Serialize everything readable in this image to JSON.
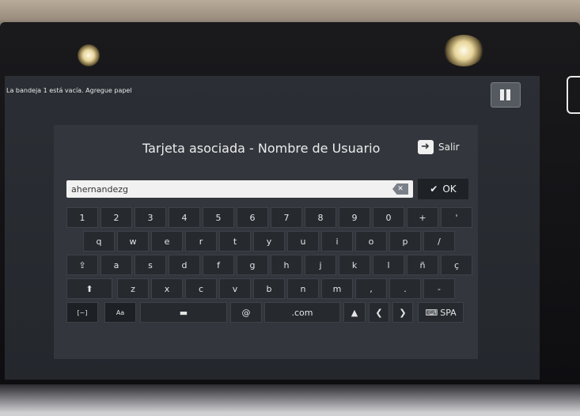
{
  "status": {
    "message": "La bandeja 1 está vacía. Agregue papel"
  },
  "header": {
    "title": "Tarjeta asociada - Nombre de Usuario",
    "exit_label": "Salir"
  },
  "input": {
    "value": "ahernandezg"
  },
  "ok": {
    "label": "OK"
  },
  "keyboard": {
    "row1": [
      "1",
      "2",
      "3",
      "4",
      "5",
      "6",
      "7",
      "8",
      "9",
      "0",
      "+",
      "'"
    ],
    "row2": [
      "q",
      "w",
      "e",
      "r",
      "t",
      "y",
      "u",
      "i",
      "o",
      "p",
      "/"
    ],
    "row3": [
      "a",
      "s",
      "d",
      "f",
      "g",
      "h",
      "j",
      "k",
      "l",
      "ñ",
      "ç"
    ],
    "row4": [
      "z",
      "x",
      "c",
      "v",
      "b",
      "n",
      "m",
      ",",
      ".",
      "-"
    ],
    "at": "@",
    "dotcom": ".com",
    "lang": "SPA",
    "case": "Aa",
    "symbols": "[~]"
  },
  "icons": [
    "pause-icon",
    "exit-icon",
    "clear-icon",
    "check-icon",
    "shift-lock-icon",
    "shift-icon",
    "space-icon",
    "up-arrow-icon",
    "left-arrow-icon",
    "right-arrow-icon",
    "keyboard-icon"
  ]
}
